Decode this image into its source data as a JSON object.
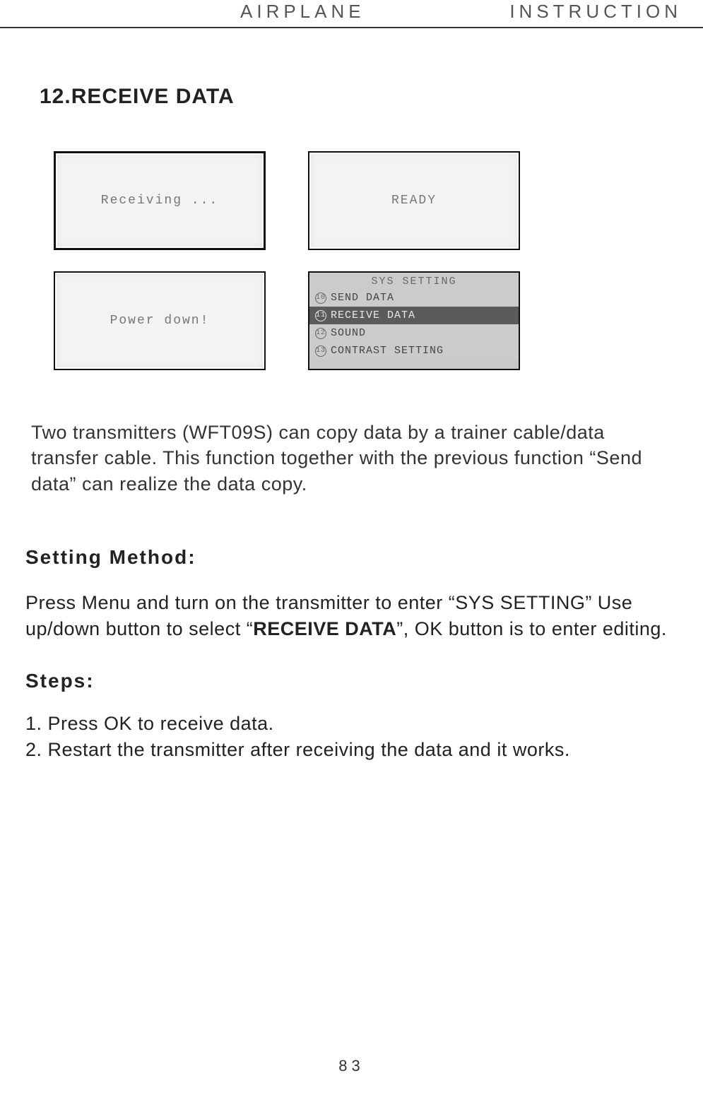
{
  "header": {
    "center": "AIRPLANE",
    "right": "INSTRUCTION"
  },
  "section_title": "12.RECEIVE DATA",
  "screens": {
    "receiving": "Receiving ...",
    "ready": "READY",
    "power_down": "Power down!",
    "menu": {
      "title": "SYS SETTING",
      "items": [
        {
          "idx": "10",
          "label": "SEND DATA",
          "selected": false
        },
        {
          "idx": "11",
          "label": "RECEIVE DATA",
          "selected": true
        },
        {
          "idx": "12",
          "label": "SOUND",
          "selected": false
        },
        {
          "idx": "13",
          "label": "CONTRAST SETTING",
          "selected": false
        }
      ]
    }
  },
  "intro": "Two transmitters (WFT09S) can copy data by a trainer cable/data transfer cable. This function together with the previous function “Send data” can realize the data copy.",
  "setting_method_heading": "Setting Method:",
  "setting_method": {
    "pre": "Press Menu and turn on the transmitter to enter “SYS SETTING” Use up/down button to select “",
    "bold": "RECEIVE DATA",
    "post": "”, OK button is to enter editing."
  },
  "steps_heading": "Steps:",
  "steps": [
    "1. Press OK to receive data.",
    "2. Restart the transmitter after receiving the data and it works."
  ],
  "page_number": "83"
}
